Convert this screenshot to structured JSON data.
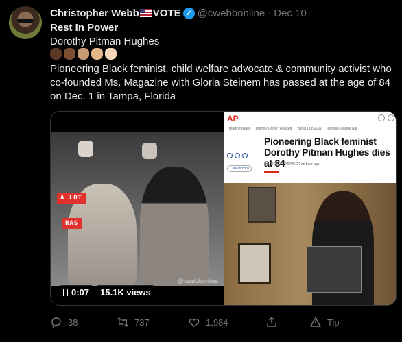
{
  "tweet": {
    "author_name": "Christopher Webb",
    "author_name_suffix": "VOTE",
    "handle": "@cwebbonline",
    "separator": "·",
    "date": "Dec 10",
    "lines": [
      "Rest In Power",
      "Dorothy Pitman Hughes",
      "Pioneering Black feminist, child welfare advocate & community activist who co-founded Ms. Magazine with Gloria Steinem has passed at the age of 84 on Dec. 1 in Tampa, Florida"
    ],
    "emoji_tones": [
      "#5a3825",
      "#7a4f34",
      "#c69a74",
      "#e4b98a",
      "#f6d7b8"
    ]
  },
  "video": {
    "overlay_words": [
      "A LOT",
      "HAS"
    ],
    "watermark": "@cwebbonline",
    "time": "0:07",
    "views": "15.1K views"
  },
  "article_image": {
    "site_logo": "AP",
    "nav_items": [
      "Trending News",
      "Brittney Griner released",
      "World Cup 2022",
      "Russia-Ukraine war"
    ],
    "copy_label": "Click to copy",
    "headline": "Pioneering Black feminist Dorothy Pitman Hughes dies at 84",
    "byline": "By JOCELYN NOVECK",
    "time_ago": "an hour ago",
    "next_icon": "chevron-right-icon"
  },
  "actions": {
    "replies": "38",
    "retweets": "737",
    "likes": "1,984",
    "tip": "Tip"
  },
  "colors": {
    "background": "#000000",
    "text": "#e7e9ea",
    "muted": "#71767b",
    "verified": "#1d9bf0",
    "tag_red": "#e0312c",
    "ap_red": "#d9281a"
  }
}
